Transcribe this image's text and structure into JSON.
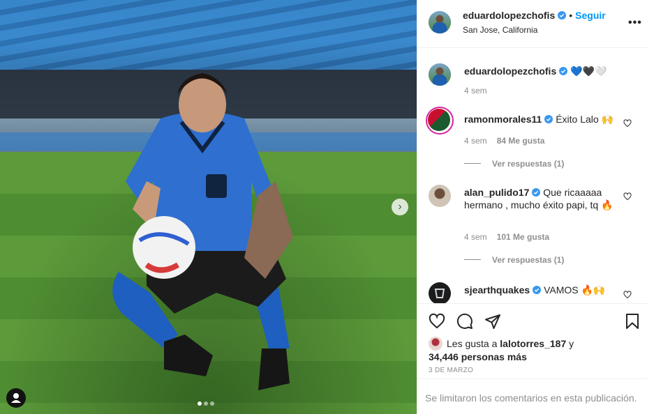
{
  "post": {
    "author": "eduardolopezchofis",
    "follow_label": "Seguir",
    "location": "San Jose, California",
    "more_label": "•••",
    "dot_separator": "•"
  },
  "caption": {
    "username": "eduardolopezchofis",
    "text": "💙🖤🤍",
    "time": "4 sem"
  },
  "comments": [
    {
      "username": "ramonmorales11",
      "text": "Éxito Lalo 🙌",
      "time": "4 sem",
      "likes": "84 Me gusta",
      "replies": "Ver respuestas (1)"
    },
    {
      "username": "alan_pulido17",
      "text": "Que ricaaaaa hermano , mucho éxito papi, tq 🔥",
      "time": "4 sem",
      "likes": "101 Me gusta",
      "replies": "Ver respuestas (1)"
    },
    {
      "username": "sjearthquakes",
      "text": "VAMOS 🔥🙌"
    }
  ],
  "likes": {
    "prefix": "Les gusta a",
    "user": "lalotorres_187",
    "joiner": "y",
    "others": "34,446 personas más"
  },
  "date": "3 DE MARZO",
  "comments_disabled": "Se limitaron los comentarios en esta publicación.",
  "carousel": {
    "current": 1,
    "total": 3
  },
  "colors": {
    "accent": "#0095f6",
    "muted": "#8e8e8e",
    "text": "#262626"
  },
  "icons": [
    "verified-icon",
    "heart-icon",
    "comment-icon",
    "share-icon",
    "bookmark-icon",
    "chevron-right-icon",
    "user-tag-icon",
    "more-icon"
  ]
}
